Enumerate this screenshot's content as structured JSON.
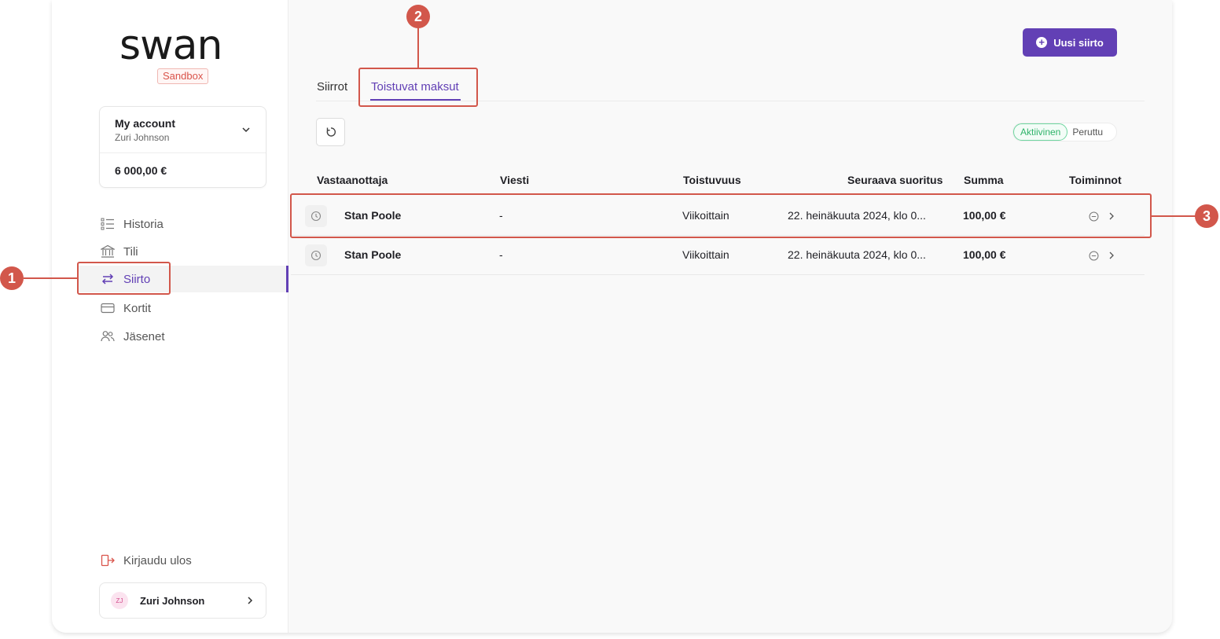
{
  "brand": {
    "logo_text": "swan",
    "env_badge": "Sandbox"
  },
  "account": {
    "name": "My account",
    "holder": "Zuri Johnson",
    "balance": "6 000,00 €"
  },
  "nav": {
    "items": [
      {
        "label": "Historia",
        "icon": "history-list-icon"
      },
      {
        "label": "Tili",
        "icon": "bank-icon"
      },
      {
        "label": "Siirto",
        "icon": "transfer-arrows-icon",
        "active": true
      },
      {
        "label": "Kortit",
        "icon": "card-icon"
      },
      {
        "label": "Jäsenet",
        "icon": "members-icon"
      }
    ],
    "logout": "Kirjaudu ulos"
  },
  "user": {
    "initials": "ZJ",
    "name": "Zuri Johnson"
  },
  "header": {
    "new_button": "Uusi siirto"
  },
  "tabs": [
    {
      "label": "Siirrot",
      "active": false
    },
    {
      "label": "Toistuvat maksut",
      "active": true
    }
  ],
  "filters": {
    "active": "Aktiivinen",
    "other": "Peruttu"
  },
  "table": {
    "columns": [
      "Vastaanottaja",
      "Viesti",
      "Toistuvuus",
      "Seuraava suoritus",
      "Summa",
      "Toiminnot"
    ],
    "rows": [
      {
        "recipient": "Stan Poole",
        "message": "-",
        "frequency": "Viikoittain",
        "next": "22. heinäkuuta 2024, klo 0...",
        "amount": "100,00 €"
      },
      {
        "recipient": "Stan Poole",
        "message": "-",
        "frequency": "Viikoittain",
        "next": "22. heinäkuuta 2024, klo 0...",
        "amount": "100,00 €"
      }
    ]
  },
  "annotations": {
    "m1": "1",
    "m2": "2",
    "m3": "3"
  },
  "colors": {
    "accent": "#6240b5",
    "highlight": "#d2574b",
    "active_green": "#2fb36a",
    "sandbox_red": "#d9534a"
  }
}
